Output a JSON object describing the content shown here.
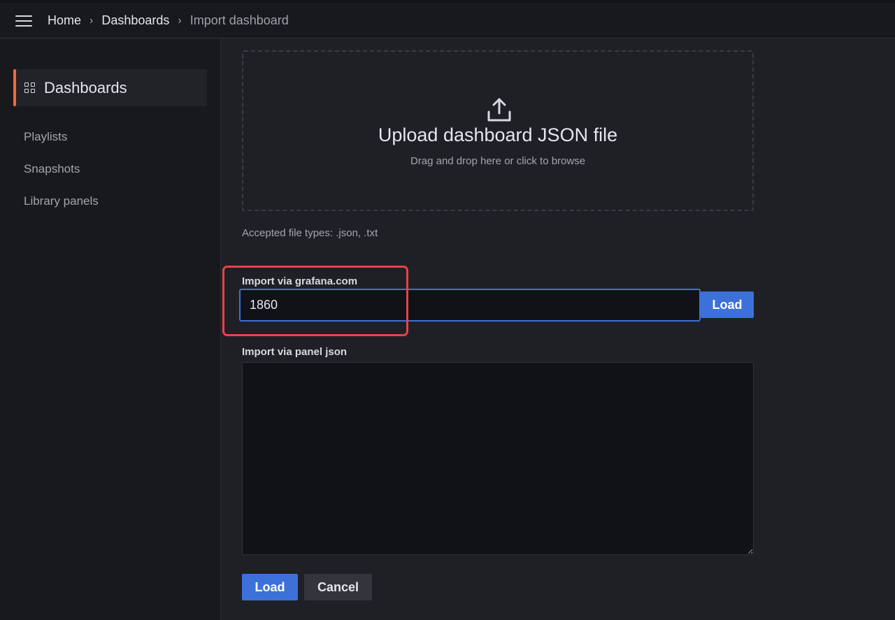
{
  "breadcrumb": {
    "items": [
      "Home",
      "Dashboards",
      "Import dashboard"
    ]
  },
  "sidebar": {
    "section_title": "Dashboards",
    "items": [
      {
        "label": "Playlists"
      },
      {
        "label": "Snapshots"
      },
      {
        "label": "Library panels"
      }
    ]
  },
  "upload": {
    "title": "Upload dashboard JSON file",
    "subtitle": "Drag and drop here or click to browse",
    "accepted": "Accepted file types: .json, .txt"
  },
  "grafana_import": {
    "label": "Import via grafana.com",
    "value": "1860",
    "button": "Load"
  },
  "panel_import": {
    "label": "Import via panel json",
    "value": ""
  },
  "actions": {
    "load": "Load",
    "cancel": "Cancel"
  },
  "colors": {
    "accent": "#3d71d9",
    "active_bar": "#f26b35",
    "highlight": "#e8424a"
  },
  "icons": {
    "menu": "hamburger-icon",
    "section": "grid-icon",
    "upload": "upload-icon",
    "separator": "chevron-right-icon"
  }
}
